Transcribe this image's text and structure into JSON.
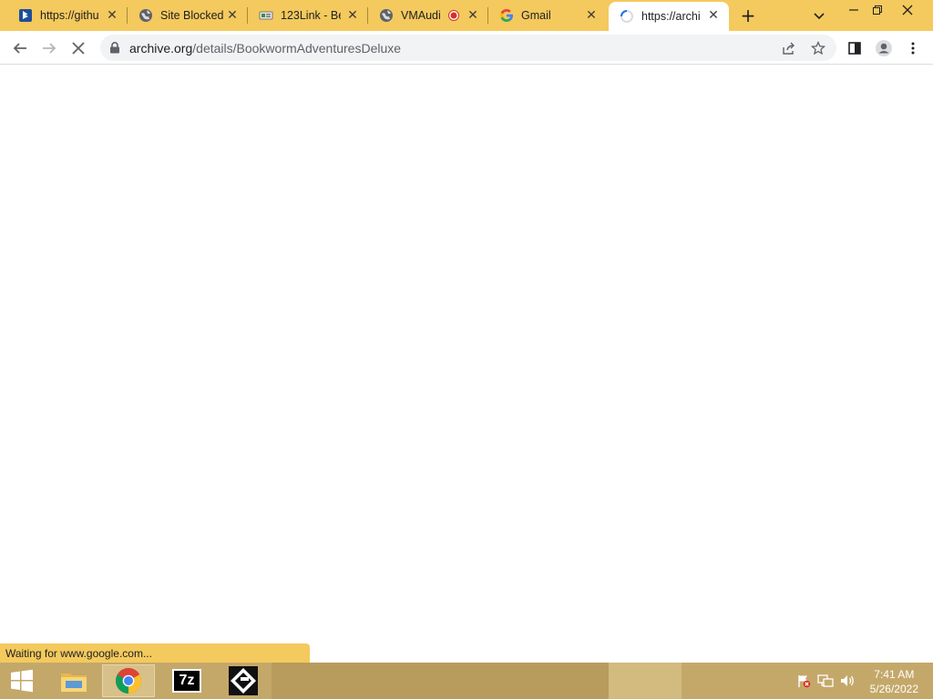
{
  "tabs": [
    {
      "title": "https://githu",
      "icon": "bing-icon"
    },
    {
      "title": "Site Blocked",
      "icon": "globe-icon"
    },
    {
      "title": "123Link - Be",
      "icon": "site-icon"
    },
    {
      "title": "VMAudi",
      "icon": "globe-icon",
      "recording": true
    },
    {
      "title": "Gmail",
      "icon": "google-icon"
    },
    {
      "title": "https://archi",
      "icon": "loading-spinner-icon",
      "active": true
    }
  ],
  "address": {
    "host": "archive.org",
    "path": "/details/BookwormAdventuresDeluxe"
  },
  "status": {
    "text": "Waiting for www.google.com..."
  },
  "taskbar": {
    "apps": [
      "file-explorer",
      "chrome",
      "7-zip",
      "app"
    ],
    "seven_zip_label": "7z",
    "time": "7:41 AM",
    "date": "5/26/2022"
  },
  "colors": {
    "frame": "#f4c95d",
    "taskbar": "#c4a86a",
    "accent_blue": "#1a73e8"
  }
}
